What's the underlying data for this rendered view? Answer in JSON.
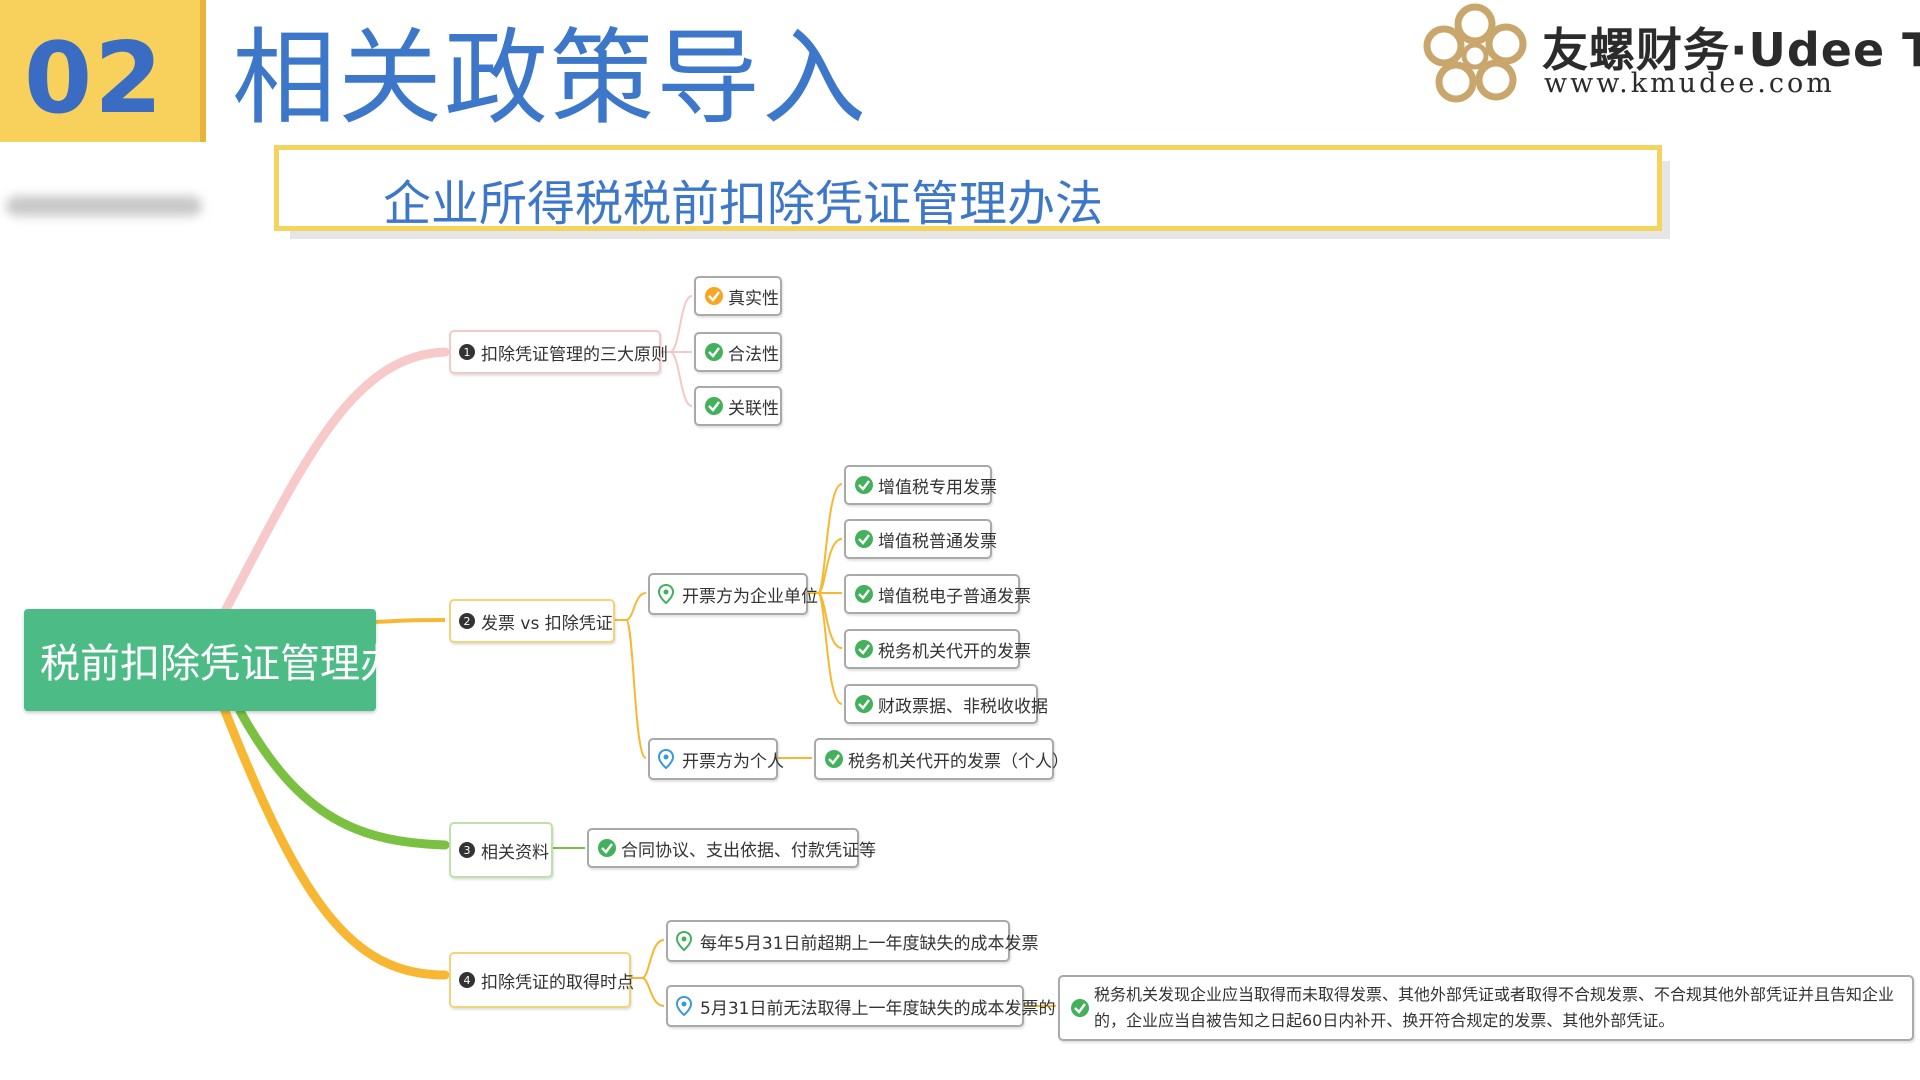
{
  "header": {
    "section_number": "02",
    "page_title": "相关政策导入",
    "subtitle": "企业所得税税前扣除凭证管理办法"
  },
  "logo": {
    "name_cn": "友螺财务·Udee Tax",
    "url": "www.kmudee.com"
  },
  "colors": {
    "accent_yellow": "#f7d15c",
    "title_blue": "#3d77c9",
    "root_green": "#4cbb85",
    "branch_pink": "#f7c9c9",
    "branch_amber": "#f7b733",
    "branch_green": "#7ac142"
  },
  "mindmap": {
    "root": "税前扣除凭证管理办法",
    "branches": [
      {
        "num": "1",
        "label": "扣除凭证管理的三大原则",
        "items": [
          "真实性",
          "合法性",
          "关联性"
        ]
      },
      {
        "num": "2",
        "label": "发票 vs 扣除凭证",
        "groups": [
          {
            "label": "开票方为企业单位",
            "items": [
              "增值税专用发票",
              "增值税普通发票",
              "增值税电子普通发票",
              "税务机关代开的发票",
              "财政票据、非税收收据"
            ]
          },
          {
            "label": "开票方为个人",
            "items": [
              "税务机关代开的发票（个人）"
            ]
          }
        ]
      },
      {
        "num": "3",
        "label": "相关资料",
        "items": [
          "合同协议、支出依据、付款凭证等"
        ]
      },
      {
        "num": "4",
        "label": "扣除凭证的取得时点",
        "groups": [
          {
            "label": "每年5月31日前超期上一年度缺失的成本发票",
            "items": []
          },
          {
            "label": "5月31日前无法取得上一年度缺失的成本发票的",
            "items": [
              "税务机关发现企业应当取得而未取得发票、其他外部凭证或者取得不合规发票、不合规其他外部凭证并且告知企业的，企业应当自被告知之日起60日内补开、换开符合规定的发票、其他外部凭证。"
            ]
          }
        ]
      }
    ]
  }
}
